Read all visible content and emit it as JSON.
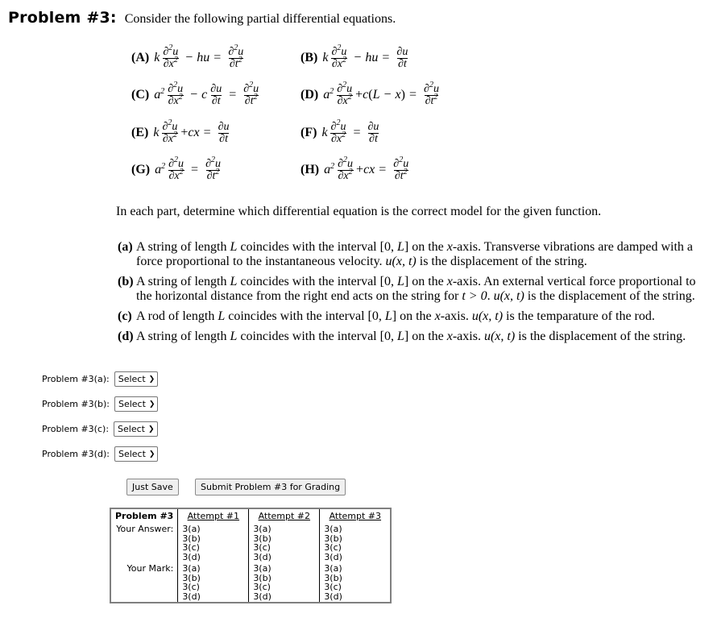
{
  "header": {
    "problem_label": "Problem #3:",
    "intro": "Consider the following partial differential equations."
  },
  "equations": [
    {
      "label": "(A)"
    },
    {
      "label": "(B)"
    },
    {
      "label": "(C)"
    },
    {
      "label": "(D)"
    },
    {
      "label": "(E)"
    },
    {
      "label": "(F)"
    },
    {
      "label": "(G)"
    },
    {
      "label": "(H)"
    }
  ],
  "instructions": "In each part, determine which differential equation is the correct model for the given function.",
  "parts": [
    {
      "label": "(a)",
      "text_1": "A string of length ",
      "var_L": "L",
      "text_2": " coincides with the interval [0, ",
      "var_L2": "L",
      "text_3": "] on the ",
      "var_x": "x",
      "text_4": "-axis. Transverse vibrations are damped with a force proportional to the instantaneous velocity. ",
      "func": "u(x, t)",
      "text_5": " is the displacement of the string."
    },
    {
      "label": "(b)",
      "text_1": "A string of length ",
      "var_L": "L",
      "text_2": " coincides with the interval [0, ",
      "var_L2": "L",
      "text_3": "] on the ",
      "var_x": "x",
      "text_4": "-axis. An external vertical force proportional to the horizontal distance from the right end acts on the string for ",
      "cond": "t > 0",
      "text_4b": ". ",
      "func": "u(x, t)",
      "text_5": " is the displacement of the string."
    },
    {
      "label": "(c)",
      "text_1": "A rod of length ",
      "var_L": "L",
      "text_2": " coincides with the interval [0, ",
      "var_L2": "L",
      "text_3": "] on the ",
      "var_x": "x",
      "text_4": "-axis. ",
      "func": "u(x, t)",
      "text_5": " is the temparature of the rod."
    },
    {
      "label": "(d)",
      "text_1": "A string of length ",
      "var_L": "L",
      "text_2": " coincides with the interval [0, ",
      "var_L2": "L",
      "text_3": "] on the ",
      "var_x": "x",
      "text_4": "-axis. ",
      "func": "u(x, t)",
      "text_5": " is the displacement of the string."
    }
  ],
  "answers": [
    {
      "label": "Problem #3(a):",
      "value": "Select"
    },
    {
      "label": "Problem #3(b):",
      "value": "Select"
    },
    {
      "label": "Problem #3(c):",
      "value": "Select"
    },
    {
      "label": "Problem #3(d):",
      "value": "Select"
    }
  ],
  "buttons": {
    "save": "Just Save",
    "submit": "Submit Problem #3 for Grading"
  },
  "attempts_table": {
    "header": "Problem #3",
    "attempts": [
      "Attempt #1",
      "Attempt #2",
      "Attempt #3"
    ],
    "answer_label": "Your Answer:",
    "mark_label": "Your Mark:",
    "answer_values": [
      [
        "3(a)",
        "3(b)",
        "3(c)",
        "3(d)"
      ],
      [
        "3(a)",
        "3(b)",
        "3(c)",
        "3(d)"
      ],
      [
        "3(a)",
        "3(b)",
        "3(c)",
        "3(d)"
      ]
    ],
    "mark_values": [
      [
        "3(a)",
        "3(b)",
        "3(c)",
        "3(d)"
      ],
      [
        "3(a)",
        "3(b)",
        "3(c)",
        "3(d)"
      ],
      [
        "3(a)",
        "3(b)",
        "3(c)",
        "3(d)"
      ]
    ]
  }
}
